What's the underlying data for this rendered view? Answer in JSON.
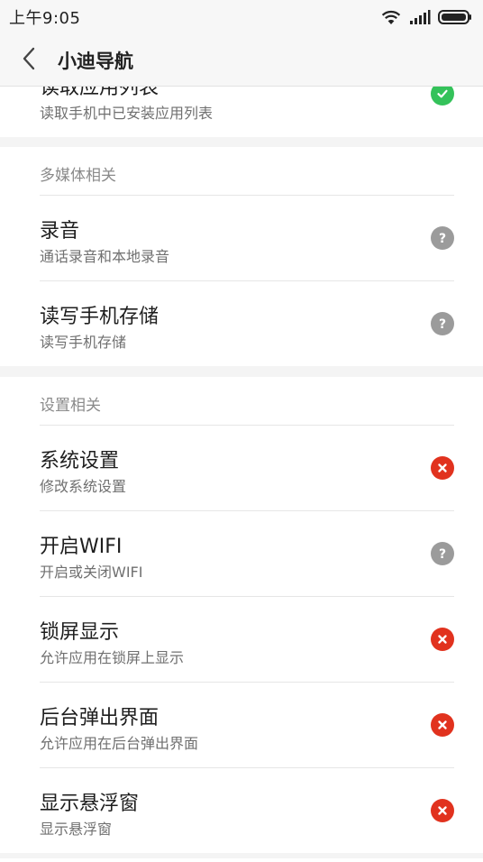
{
  "status_bar": {
    "time": "上午9:05"
  },
  "header": {
    "title": "小迪导航"
  },
  "colors": {
    "ok": "#34c25a",
    "unknown": "#9b9b9b",
    "denied": "#e1321e"
  },
  "partial_item": {
    "title": "读取应用列表",
    "subtitle": "读取手机中已安装应用列表",
    "status": "ok",
    "status_icon": "check-icon"
  },
  "sections": [
    {
      "header": "多媒体相关",
      "items": [
        {
          "title": "录音",
          "subtitle": "通话录音和本地录音",
          "status": "unknown",
          "status_icon": "question-icon"
        },
        {
          "title": "读写手机存储",
          "subtitle": "读写手机存储",
          "status": "unknown",
          "status_icon": "question-icon"
        }
      ]
    },
    {
      "header": "设置相关",
      "items": [
        {
          "title": "系统设置",
          "subtitle": "修改系统设置",
          "status": "denied",
          "status_icon": "cross-icon"
        },
        {
          "title": "开启WIFI",
          "subtitle": "开启或关闭WIFI",
          "status": "unknown",
          "status_icon": "question-icon"
        },
        {
          "title": "锁屏显示",
          "subtitle": "允许应用在锁屏上显示",
          "status": "denied",
          "status_icon": "cross-icon"
        },
        {
          "title": "后台弹出界面",
          "subtitle": "允许应用在后台弹出界面",
          "status": "denied",
          "status_icon": "cross-icon"
        },
        {
          "title": "显示悬浮窗",
          "subtitle": "显示悬浮窗",
          "status": "denied",
          "status_icon": "cross-icon"
        }
      ]
    }
  ]
}
